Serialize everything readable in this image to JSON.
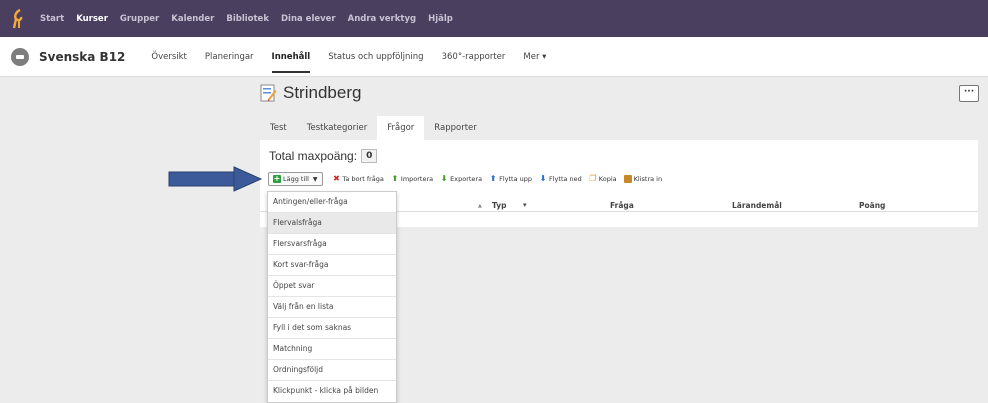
{
  "topnav": {
    "items": [
      "Start",
      "Kurser",
      "Grupper",
      "Kalender",
      "Bibliotek",
      "Dina elever",
      "Andra verktyg",
      "Hjälp"
    ],
    "active_index": 1
  },
  "course": {
    "title": "Svenska B12",
    "tabs": [
      "Översikt",
      "Planeringar",
      "Innehåll",
      "Status och uppföljning",
      "360°-rapporter",
      "Mer ▾"
    ],
    "active_index": 2
  },
  "page": {
    "title": "Strindberg",
    "more_button": "···",
    "tabs": [
      "Test",
      "Testkategorier",
      "Frågor",
      "Rapporter"
    ],
    "active_tab_index": 2
  },
  "panel": {
    "max_label": "Total maxpoäng:",
    "max_value": "0",
    "toolbar": {
      "add": "Lägg till",
      "delete": "Ta bort fråga",
      "import": "Importera",
      "export": "Exportera",
      "move_up": "Flytta upp",
      "move_down": "Flytta ned",
      "copy": "Kopia",
      "paste": "Klistra in"
    },
    "columns": {
      "sort_marker": "▲",
      "type": "Typ",
      "type_menu": "▾",
      "question": "Fråga",
      "objective": "Lärandemål",
      "points": "Poäng"
    }
  },
  "dropdown": {
    "items": [
      "Antingen/eller-fråga",
      "Flervalsfråga",
      "Flersvarsfråga",
      "Kort svar-fråga",
      "Öppet svar",
      "Välj från en lista",
      "Fyll i det som saknas",
      "Matchning",
      "Ordningsföljd",
      "Klickpunkt - klicka på bilden"
    ],
    "hover_index": 1
  },
  "colors": {
    "topnav_bg": "#4a3f5e",
    "arrow": "#3c5a9a",
    "add_icon": "#2e9e3e",
    "delete_icon": "#d42a2a",
    "import_icon": "#4a9e2e",
    "move_icon": "#2a6fd4"
  },
  "icons": {
    "logo": "itslearning-logo",
    "course": "course-icon",
    "page": "test-icon",
    "add": "plus-icon",
    "delete": "x-icon",
    "import": "arrow-up-icon",
    "export": "arrow-down-icon",
    "move_up": "arrow-up-icon",
    "move_down": "arrow-down-icon",
    "copy": "copy-icon",
    "paste": "paste-icon",
    "annotation": "pointer-arrow-icon"
  }
}
